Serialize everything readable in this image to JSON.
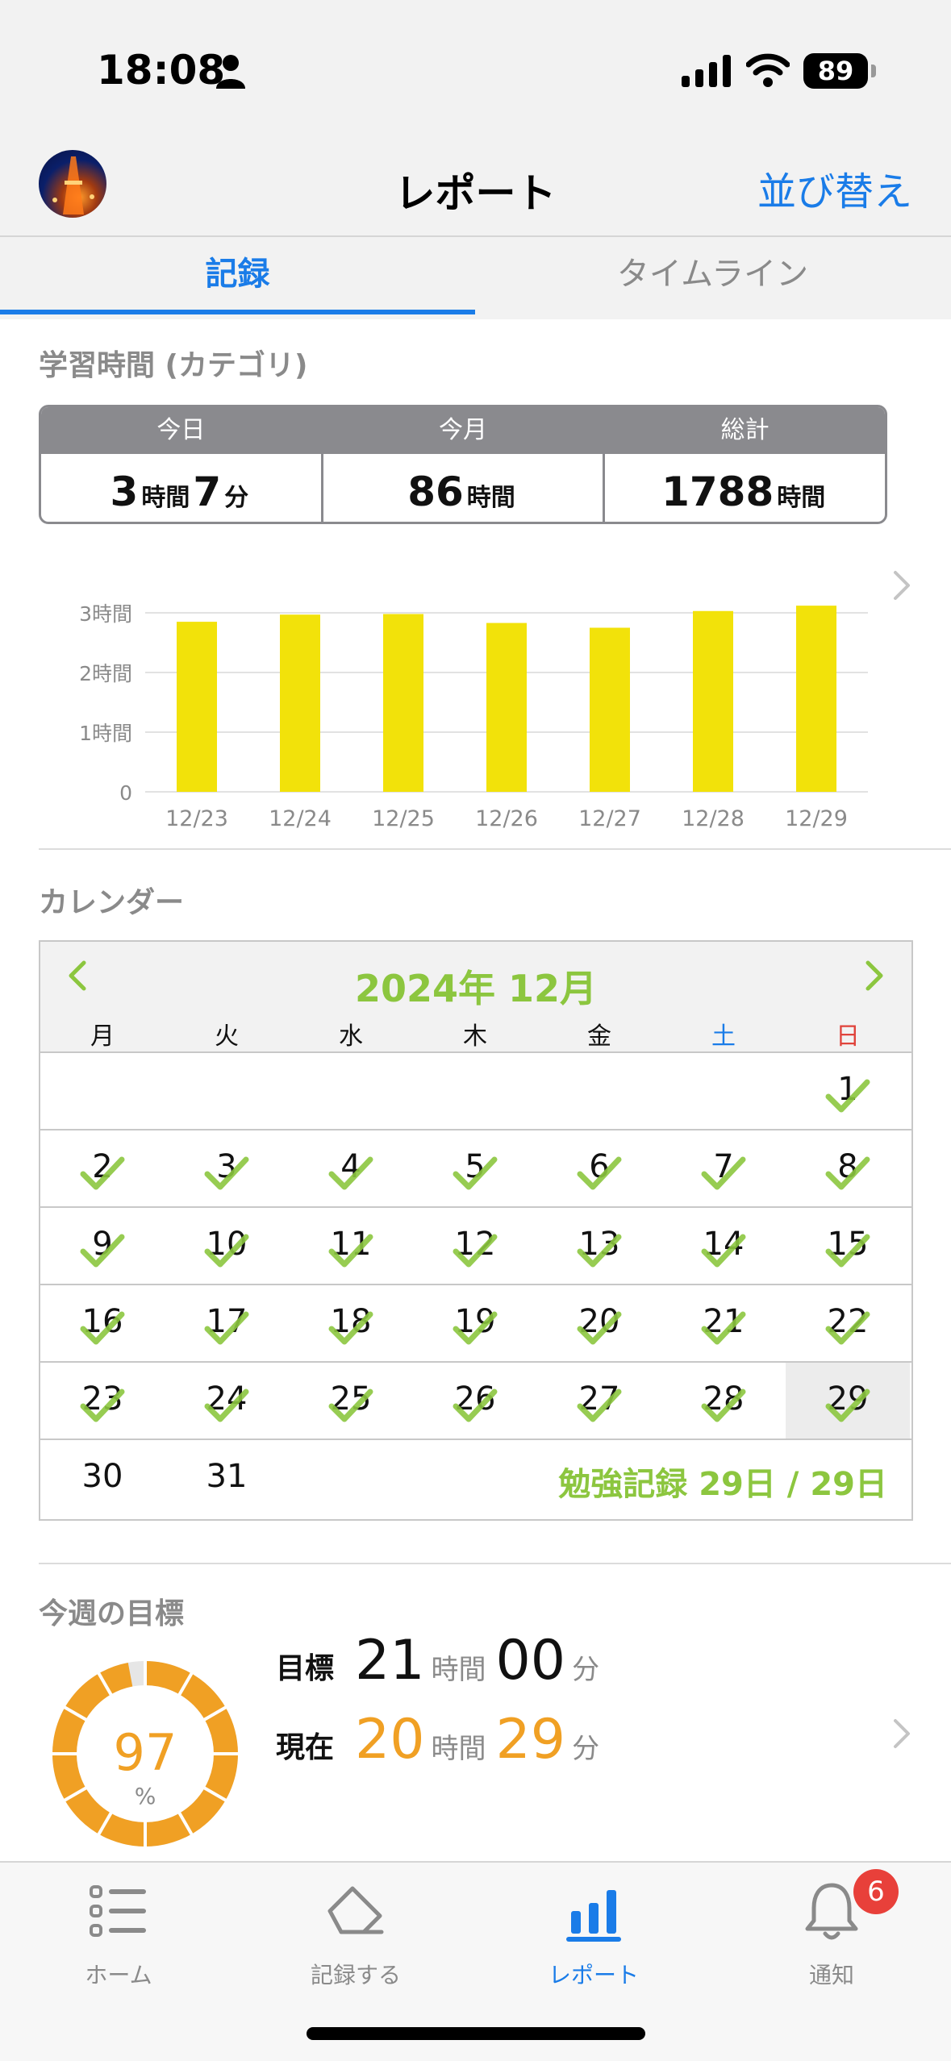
{
  "status": {
    "time": "18:08",
    "battery": "89"
  },
  "nav": {
    "title": "レポート",
    "sort_label": "並び替え"
  },
  "tabs": [
    {
      "label": "記録"
    },
    {
      "label": "タイムライン"
    }
  ],
  "study_section": {
    "title": "学習時間 (カテゴリ)"
  },
  "stats": {
    "today": {
      "label": "今日",
      "hours": "3",
      "hours_unit": "時間",
      "minutes": "7",
      "minutes_unit": "分"
    },
    "month": {
      "label": "今月",
      "value": "86",
      "unit": "時間"
    },
    "total": {
      "label": "総計",
      "value": "1788",
      "unit": "時間"
    }
  },
  "chart_data": {
    "type": "bar",
    "categories": [
      "12/23",
      "12/24",
      "12/25",
      "12/26",
      "12/27",
      "12/28",
      "12/29"
    ],
    "values": [
      2.85,
      2.97,
      2.98,
      2.83,
      2.75,
      3.03,
      3.12
    ],
    "ylim": [
      0,
      3
    ],
    "yticks": [
      "0",
      "1時間",
      "2時間",
      "3時間"
    ],
    "bar_color": "#f2e20a",
    "grid": true
  },
  "calendar": {
    "section_title": "カレンダー",
    "month_label": "2024年 12月",
    "prev": "<",
    "next": ">",
    "weekdays": [
      "月",
      "火",
      "水",
      "木",
      "金",
      "土",
      "日"
    ],
    "days_in_month": 31,
    "first_weekday_index": 6,
    "checked_days": [
      1,
      2,
      3,
      4,
      5,
      6,
      7,
      8,
      9,
      10,
      11,
      12,
      13,
      14,
      15,
      16,
      17,
      18,
      19,
      20,
      21,
      22,
      23,
      24,
      25,
      26,
      27,
      28,
      29
    ],
    "today": 29,
    "summary": "勉強記録 29日 / 29日",
    "accent_color": "#8cc63f"
  },
  "goal": {
    "section_title": "今週の目標",
    "percent": 97,
    "percent_label": "97",
    "percent_sign": "%",
    "target_label": "目標",
    "target_hours": "21",
    "target_minutes": "00",
    "current_label": "現在",
    "current_hours": "20",
    "current_minutes": "29",
    "hours_unit": "時間",
    "minutes_unit": "分",
    "color": "#f0a024"
  },
  "tabbar": {
    "items": [
      {
        "label": "ホーム",
        "icon": "list-icon"
      },
      {
        "label": "記録する",
        "icon": "pencil-icon"
      },
      {
        "label": "レポート",
        "icon": "bar-chart-icon"
      },
      {
        "label": "通知",
        "icon": "bell-icon"
      }
    ],
    "badge": "6"
  },
  "colors": {
    "accent_blue": "#1a7ce8",
    "calendar_green": "#8cc63f",
    "goal_orange": "#f0a024"
  }
}
